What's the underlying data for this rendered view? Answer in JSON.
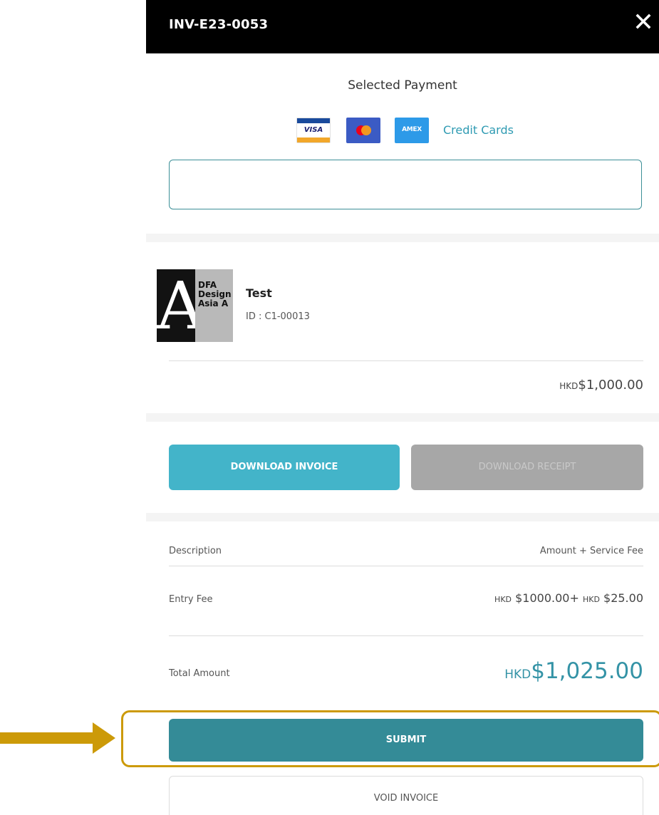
{
  "modal": {
    "title": "INV-E23-0053",
    "close_icon": "close-icon"
  },
  "payment": {
    "selected_label": "Selected Payment",
    "cards": [
      {
        "name": "visa",
        "text": "VISA",
        "color": "#1a1f71"
      },
      {
        "name": "mastercard",
        "text": "",
        "color": "#3b5bc4"
      },
      {
        "name": "amex",
        "text": "AMEX",
        "color": "#2d9ae8"
      }
    ],
    "cards_label": "Credit Cards",
    "card_input_value": ""
  },
  "entry": {
    "thumbnail_text": "DFA\nDesign\nAsia A",
    "title": "Test",
    "id_text": "ID : C1-00013",
    "subtotal_currency": "HKD",
    "subtotal_amount": "$1,000.00"
  },
  "actions": {
    "download_invoice": "DOWNLOAD INVOICE",
    "download_receipt": "DOWNLOAD RECEIPT"
  },
  "breakdown": {
    "header_description": "Description",
    "header_amount": "Amount + Service Fee",
    "row_label": "Entry Fee",
    "row_currency_1": "HKD",
    "row_amount_1": "$1000.00+",
    "row_currency_2": "HKD",
    "row_amount_2": "$25.00",
    "total_label": "Total Amount",
    "total_currency": "HKD",
    "total_amount": "$1,025.00"
  },
  "footer": {
    "submit_label": "SUBMIT",
    "void_label": "VOID INVOICE"
  },
  "colors": {
    "accent": "#43b4c9",
    "submit": "#348b97",
    "highlight": "#cc9a08",
    "header_bg": "#000000"
  }
}
